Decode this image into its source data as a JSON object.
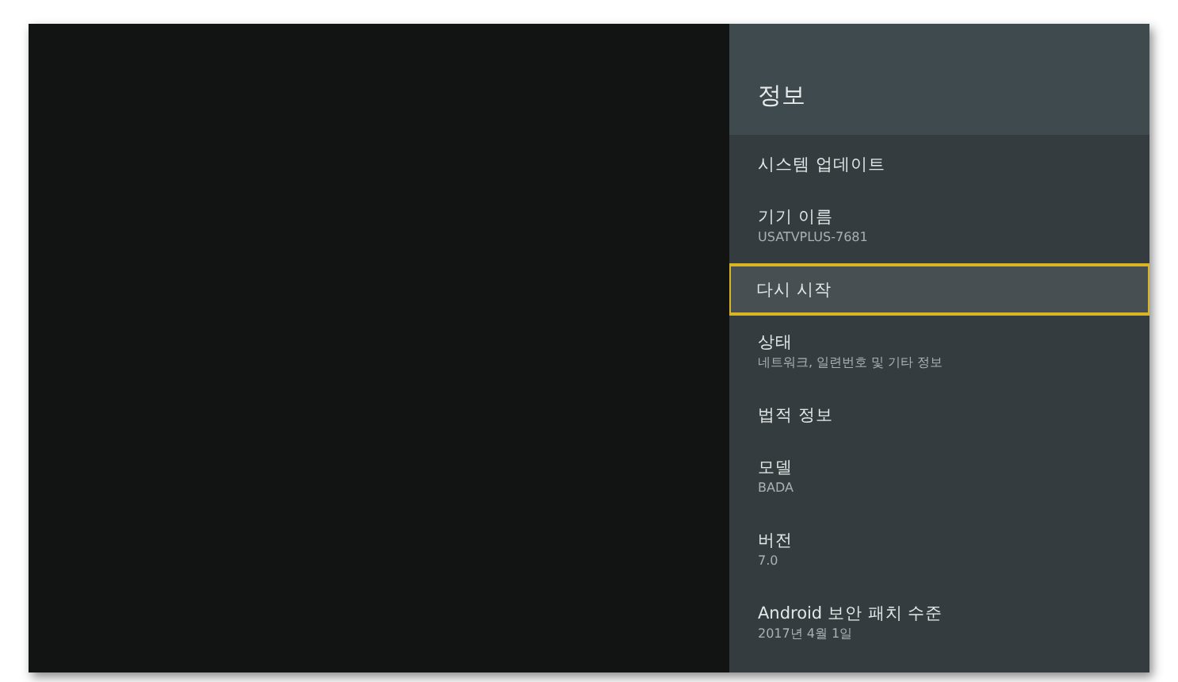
{
  "panel": {
    "title": "정보"
  },
  "items": [
    {
      "label": "시스템 업데이트",
      "selected": false
    },
    {
      "label": "기기 이름",
      "subtitle": "USATVPLUS-7681",
      "selected": false
    },
    {
      "label": "다시 시작",
      "selected": true
    },
    {
      "label": "상태",
      "subtitle": "네트워크, 일련번호 및 기타 정보",
      "selected": false
    },
    {
      "label": "법적 정보",
      "selected": false
    },
    {
      "label": "모델",
      "subtitle": "BADA",
      "selected": false
    },
    {
      "label": "버전",
      "subtitle": "7.0",
      "selected": false
    },
    {
      "label": "Android 보안 패치 수준",
      "subtitle": "2017년 4월 1일",
      "selected": false
    }
  ]
}
